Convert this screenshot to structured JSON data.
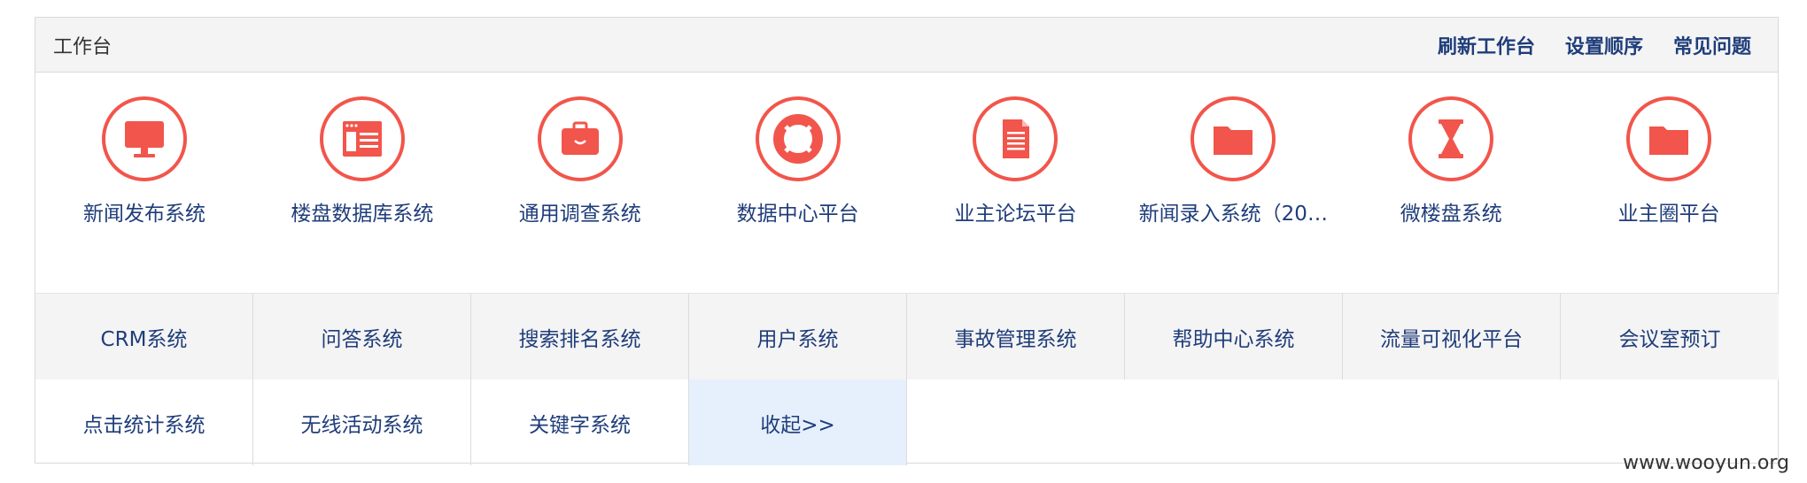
{
  "header": {
    "title": "工作台",
    "actions": [
      "刷新工作台",
      "设置顺序",
      "常见问题"
    ]
  },
  "apps": [
    {
      "label": "新闻发布系统",
      "icon": "monitor-icon"
    },
    {
      "label": "楼盘数据库系统",
      "icon": "browser-window-icon"
    },
    {
      "label": "通用调查系统",
      "icon": "briefcase-icon"
    },
    {
      "label": "数据中心平台",
      "icon": "lifebuoy-icon"
    },
    {
      "label": "业主论坛平台",
      "icon": "document-icon"
    },
    {
      "label": "新闻录入系统（20…",
      "icon": "folder-icon"
    },
    {
      "label": "微楼盘系统",
      "icon": "hourglass-icon"
    },
    {
      "label": "业主圈平台",
      "icon": "folder-icon"
    }
  ],
  "systems_row1": [
    "CRM系统",
    "问答系统",
    "搜索排名系统",
    "用户系统",
    "事故管理系统",
    "帮助中心系统",
    "流量可视化平台",
    "会议室预订"
  ],
  "systems_row2": [
    "点击统计系统",
    "无线活动系统",
    "关键字系统",
    "收起>>"
  ],
  "colors": {
    "accent": "#f2554b",
    "link": "#1f3d7a",
    "collapse_bg": "#e6f0fd"
  },
  "watermark": "www.wooyun.org"
}
